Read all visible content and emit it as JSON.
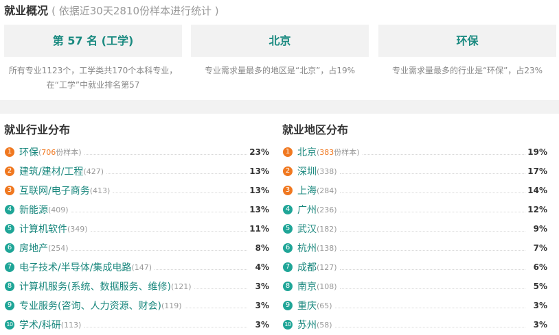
{
  "header": {
    "title": "就业概况",
    "subtitle": "( 依据近30天2810份样本进行统计 )"
  },
  "cards": [
    {
      "value": "第 57 名 (工学)",
      "desc": "所有专业1123个，工学类共170个本科专业，在“工学”中就业排名第57"
    },
    {
      "value": "北京",
      "desc": "专业需求量最多的地区是“北京”，占19%"
    },
    {
      "value": "环保",
      "desc": "专业需求量最多的行业是“环保”，占23%"
    }
  ],
  "industry": {
    "title": "就业行业分布",
    "items": [
      {
        "rank": "1",
        "name": "环保",
        "count_prefix": "(",
        "count_value": "706",
        "count_suffix": "份样本)",
        "pct": "23%"
      },
      {
        "rank": "2",
        "name": "建筑/建材/工程",
        "count_prefix": "",
        "count_value": "",
        "count_suffix": "(427)",
        "pct": "13%"
      },
      {
        "rank": "3",
        "name": "互联网/电子商务",
        "count_prefix": "",
        "count_value": "",
        "count_suffix": "(413)",
        "pct": "13%"
      },
      {
        "rank": "4",
        "name": "新能源",
        "count_prefix": "",
        "count_value": "",
        "count_suffix": "(409)",
        "pct": "13%"
      },
      {
        "rank": "5",
        "name": "计算机软件",
        "count_prefix": "",
        "count_value": "",
        "count_suffix": "(349)",
        "pct": "11%"
      },
      {
        "rank": "6",
        "name": "房地产",
        "count_prefix": "",
        "count_value": "",
        "count_suffix": "(254)",
        "pct": "8%"
      },
      {
        "rank": "7",
        "name": "电子技术/半导体/集成电路",
        "count_prefix": "",
        "count_value": "",
        "count_suffix": "(147)",
        "pct": "4%"
      },
      {
        "rank": "8",
        "name": "计算机服务(系统、数据服务、维修)",
        "count_prefix": "",
        "count_value": "",
        "count_suffix": "(121)",
        "pct": "3%"
      },
      {
        "rank": "9",
        "name": "专业服务(咨询、人力资源、财会)",
        "count_prefix": "",
        "count_value": "",
        "count_suffix": "(119)",
        "pct": "3%"
      },
      {
        "rank": "10",
        "name": "学术/科研",
        "count_prefix": "",
        "count_value": "",
        "count_suffix": "(113)",
        "pct": "3%"
      }
    ]
  },
  "region": {
    "title": "就业地区分布",
    "items": [
      {
        "rank": "1",
        "name": "北京",
        "count_prefix": "(",
        "count_value": "383",
        "count_suffix": "份样本)",
        "pct": "19%"
      },
      {
        "rank": "2",
        "name": "深圳",
        "count_prefix": "",
        "count_value": "",
        "count_suffix": "(338)",
        "pct": "17%"
      },
      {
        "rank": "3",
        "name": "上海",
        "count_prefix": "",
        "count_value": "",
        "count_suffix": "(284)",
        "pct": "14%"
      },
      {
        "rank": "4",
        "name": "广州",
        "count_prefix": "",
        "count_value": "",
        "count_suffix": "(236)",
        "pct": "12%"
      },
      {
        "rank": "5",
        "name": "武汉",
        "count_prefix": "",
        "count_value": "",
        "count_suffix": "(182)",
        "pct": "9%"
      },
      {
        "rank": "6",
        "name": "杭州",
        "count_prefix": "",
        "count_value": "",
        "count_suffix": "(138)",
        "pct": "7%"
      },
      {
        "rank": "7",
        "name": "成都",
        "count_prefix": "",
        "count_value": "",
        "count_suffix": "(127)",
        "pct": "6%"
      },
      {
        "rank": "8",
        "name": "南京",
        "count_prefix": "",
        "count_value": "",
        "count_suffix": "(108)",
        "pct": "5%"
      },
      {
        "rank": "9",
        "name": "重庆",
        "count_prefix": "",
        "count_value": "",
        "count_suffix": "(65)",
        "pct": "3%"
      },
      {
        "rank": "10",
        "name": "苏州",
        "count_prefix": "",
        "count_value": "",
        "count_suffix": "(58)",
        "pct": "3%"
      }
    ]
  },
  "colors": {
    "accent": "#19877d",
    "hot_badge": "#f07820",
    "normal_badge": "#1fa597",
    "panel_bg": "#f2f2f2"
  }
}
